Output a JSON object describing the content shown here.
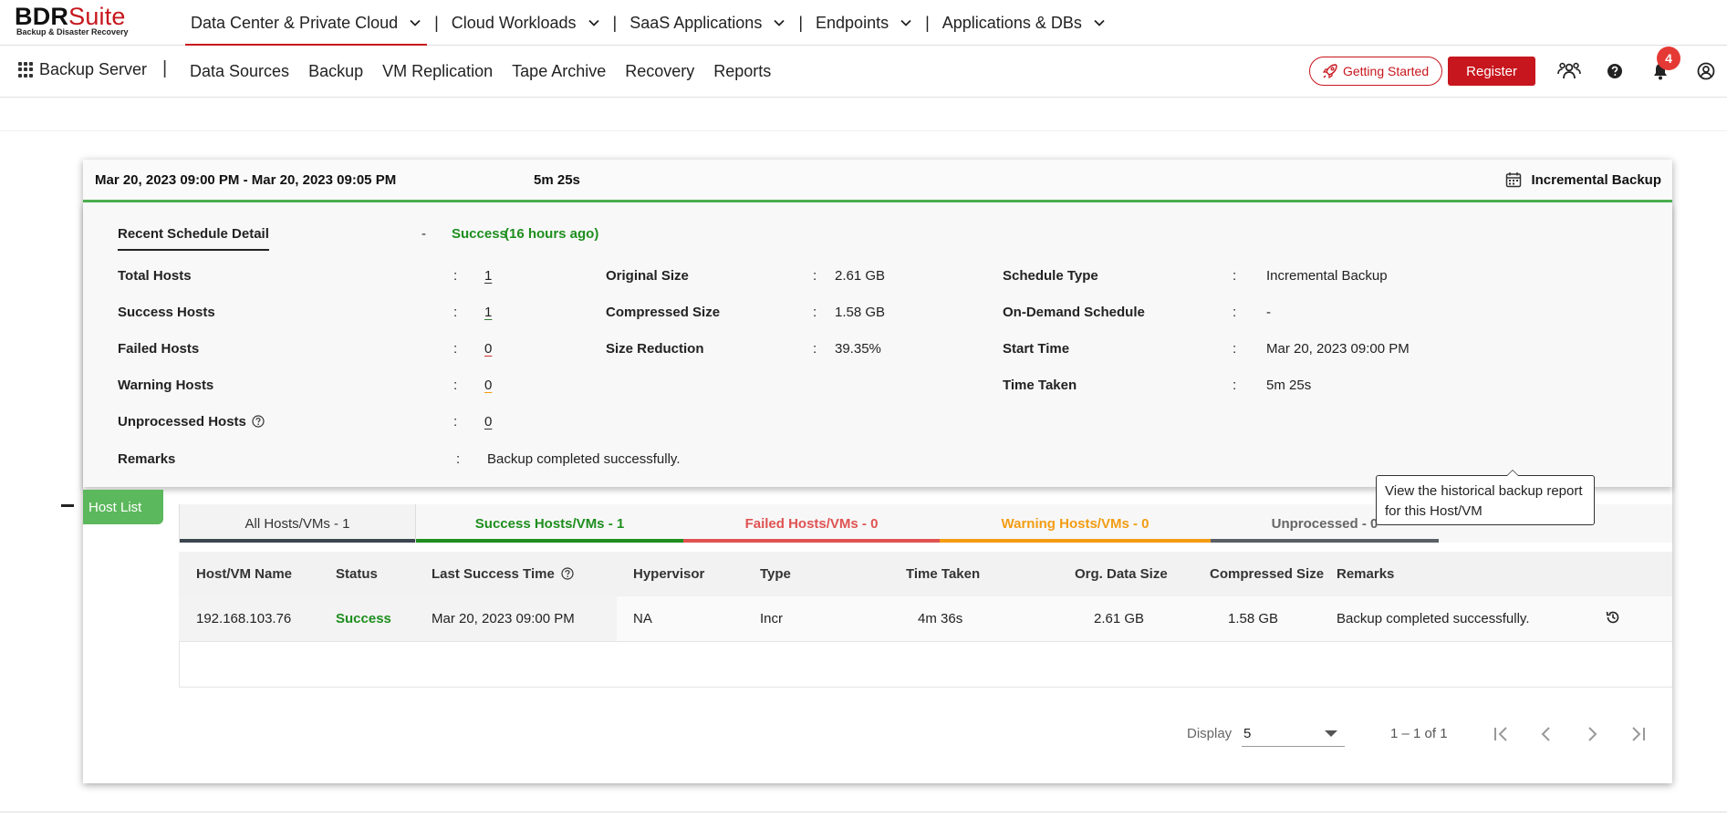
{
  "logo": {
    "bdr": "BDR",
    "suite": "Suite",
    "tagline": "Backup & Disaster Recovery"
  },
  "topnav": {
    "items": [
      {
        "label": "Data Center & Private Cloud"
      },
      {
        "label": "Cloud Workloads"
      },
      {
        "label": "SaaS Applications"
      },
      {
        "label": "Endpoints"
      },
      {
        "label": "Applications & DBs"
      }
    ],
    "separator": "|"
  },
  "subnav": {
    "app_name": "Backup Server",
    "separator": "|",
    "items": [
      "Data Sources",
      "Backup",
      "VM Replication",
      "Tape Archive",
      "Recovery",
      "Reports"
    ],
    "getting_started": "Getting Started",
    "register": "Register",
    "notification_count": "4",
    "icons": [
      "users-icon",
      "help-icon",
      "bell-icon",
      "account-icon"
    ]
  },
  "card": {
    "time_range": "Mar 20, 2023 09:00 PM - Mar 20, 2023 09:05 PM",
    "duration": "5m 25s",
    "backup_type": "Incremental Backup",
    "recent_label": "Recent Schedule Detail",
    "recent_dash": "-",
    "recent_status": "Success",
    "recent_ago": "(16 hours ago)",
    "colon": ":",
    "hosts": {
      "total_label": "Total Hosts",
      "total": "1",
      "success_label": "Success Hosts",
      "success": "1",
      "failed_label": "Failed Hosts",
      "failed": "0",
      "warning_label": "Warning Hosts",
      "warning": "0",
      "unprocessed_label": "Unprocessed Hosts",
      "unprocessed": "0",
      "remarks_label": "Remarks",
      "remarks": "Backup completed successfully."
    },
    "sizes": {
      "original_label": "Original Size",
      "original": "2.61 GB",
      "compressed_label": "Compressed Size",
      "compressed": "1.58 GB",
      "reduction_label": "Size Reduction",
      "reduction": "39.35%"
    },
    "schedule": {
      "type_label": "Schedule Type",
      "type": "Incremental Backup",
      "ondemand_label": "On-Demand Schedule",
      "ondemand": "-",
      "start_label": "Start Time",
      "start": "Mar 20, 2023 09:00 PM",
      "taken_label": "Time Taken",
      "taken": "5m 25s"
    }
  },
  "hostlist": {
    "tab_label": "Host List",
    "tabs": {
      "all": "All Hosts/VMs - 1",
      "success": "Success Hosts/VMs - 1",
      "failed": "Failed Hosts/VMs - 0",
      "warning": "Warning Hosts/VMs - 0",
      "unprocessed": "Unprocessed - 0"
    },
    "columns": [
      "Host/VM Name",
      "Status",
      "Last Success Time",
      "Hypervisor",
      "Type",
      "Time Taken",
      "Org. Data Size",
      "Compressed Size",
      "Remarks"
    ],
    "rows": [
      {
        "name": "192.168.103.76",
        "status": "Success",
        "last_success": "Mar 20, 2023 09:00 PM",
        "hypervisor": "NA",
        "type": "Incr",
        "time_taken": "4m 36s",
        "org_size": "2.61 GB",
        "compressed": "1.58 GB",
        "remarks": "Backup completed successfully."
      }
    ],
    "tooltip": "View the historical backup report for this Host/VM"
  },
  "pagination": {
    "display_label": "Display",
    "page_size": "5",
    "range": "1 – 1 of 1"
  },
  "colors": {
    "brand_red": "#c7161d",
    "success_green": "#1e8e1e",
    "failed_red": "#e05252",
    "warning_orange": "#f39c12",
    "host_tab_green": "#5cb85c"
  }
}
